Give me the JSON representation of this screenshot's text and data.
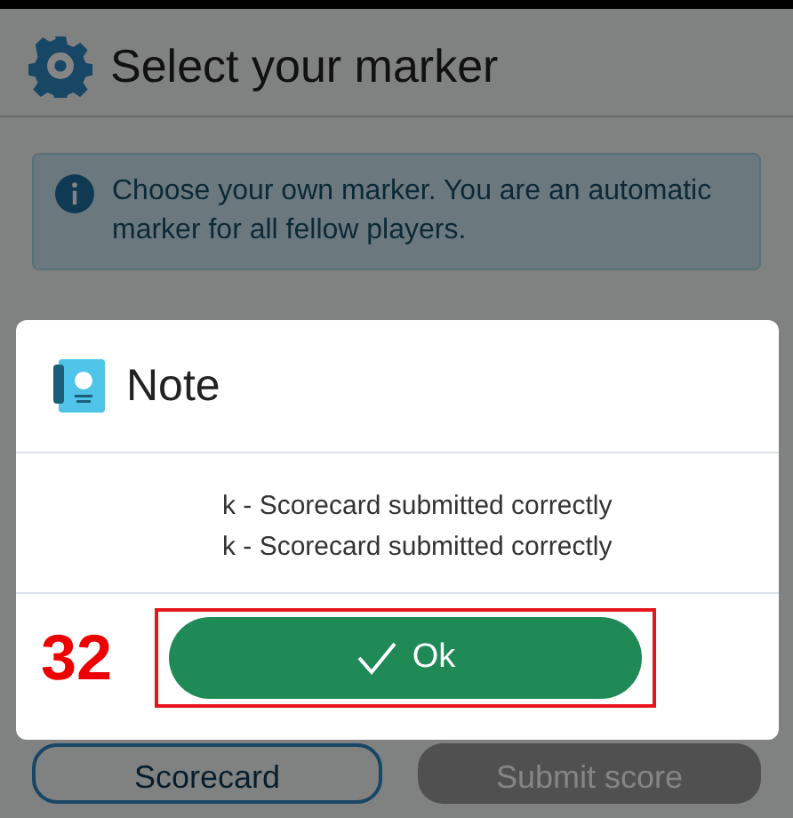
{
  "page": {
    "title": "Select your marker",
    "info": "Choose your own marker. You are an automatic marker for all fellow players.",
    "buttons": [
      {
        "label": "Scorecard",
        "kind": "outline"
      },
      {
        "label": "Submit score",
        "kind": "disabled"
      }
    ]
  },
  "dialog": {
    "title": "Note",
    "messages": [
      "k - Scorecard submitted correctly",
      "k - Scorecard submitted correctly"
    ],
    "ok_button": "Ok"
  },
  "annotation": {
    "label": "32"
  }
}
